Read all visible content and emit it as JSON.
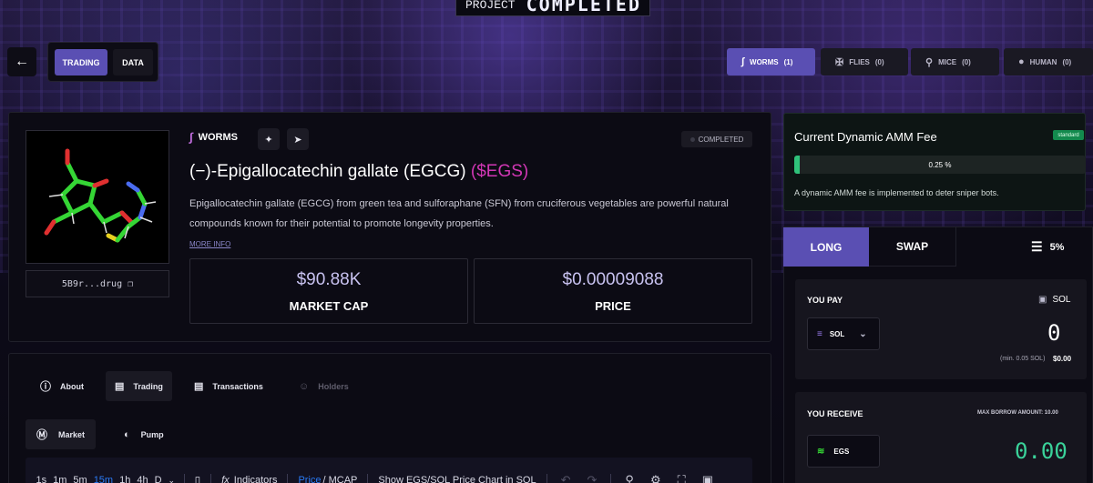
{
  "banner": {
    "project": "PROJECT",
    "state": "COMPLETED"
  },
  "nav": {
    "back_icon": "arrow-left-icon",
    "tabs": [
      {
        "label": "TRADING",
        "active": true
      },
      {
        "label": "DATA",
        "active": false
      }
    ]
  },
  "species_tabs": [
    {
      "label": "WORMS",
      "count": "(1)",
      "icon": "worm-icon",
      "active": true
    },
    {
      "label": "FLIES",
      "count": "(0)",
      "icon": "fly-icon",
      "active": false
    },
    {
      "label": "MICE",
      "count": "(0)",
      "icon": "mouse-icon",
      "active": false
    },
    {
      "label": "HUMAN",
      "count": "(0)",
      "icon": "person-icon",
      "active": false
    }
  ],
  "token": {
    "address_short": "5B9r...drug",
    "community": "WORMS",
    "status": "COMPLETED",
    "name": "(−)-Epigallocatechin gallate (EGCG)",
    "ticker": "($EGS)",
    "description": "Epigallocatechin gallate (EGCG) from green tea and sulforaphane (SFN) from cruciferous vegetables are powerful natural compounds known for their potential to promote longevity properties.",
    "more_info": "MORE INFO",
    "market_cap": {
      "value": "$90.88K",
      "label": "MARKET CAP"
    },
    "price": {
      "value": "$0.00009088",
      "label": "PRICE"
    }
  },
  "section_tabs": [
    {
      "label": "About",
      "icon": "info-icon",
      "active": false,
      "dim": false
    },
    {
      "label": "Trading",
      "icon": "bar-chart-icon",
      "active": true,
      "dim": false
    },
    {
      "label": "Transactions",
      "icon": "bar-chart-icon",
      "active": false,
      "dim": false
    },
    {
      "label": "Holders",
      "icon": "people-icon",
      "active": false,
      "dim": true
    }
  ],
  "market_tabs": [
    {
      "label": "Market",
      "icon": "pulse-icon",
      "active": true
    },
    {
      "label": "Pump",
      "icon": "pill-icon",
      "active": false
    }
  ],
  "chart_toolbar": {
    "timeframes": [
      {
        "label": "1s",
        "active": false
      },
      {
        "label": "1m",
        "active": false
      },
      {
        "label": "5m",
        "active": false
      },
      {
        "label": "15m",
        "active": true
      },
      {
        "label": "1h",
        "active": false
      },
      {
        "label": "4h",
        "active": false
      },
      {
        "label": "D",
        "active": false
      }
    ],
    "indicators": "Indicators",
    "price": "Price",
    "mcap": "MCAP",
    "pair_toggle": "Show EGS/SOL Price Chart in SOL"
  },
  "fee": {
    "title": "Current Dynamic AMM Fee",
    "badge": "standard",
    "value_label": "0.25 %",
    "fill_fraction": 0.02,
    "note": "A dynamic AMM fee is implemented to deter sniper bots."
  },
  "trade": {
    "long_label": "LONG",
    "swap_label": "SWAP",
    "slippage": "5%",
    "pay_label": "YOU PAY",
    "pay_currency": "SOL",
    "pay_token": "SOL",
    "pay_amount": "0",
    "min_note": "(min. 0.05 SOL)",
    "min_value": "$0.00",
    "receive_label": "YOU RECEIVE",
    "max_borrow": "MAX BORROW AMOUNT: 10.00",
    "receive_token": "EGS",
    "receive_amount": "0.00"
  }
}
